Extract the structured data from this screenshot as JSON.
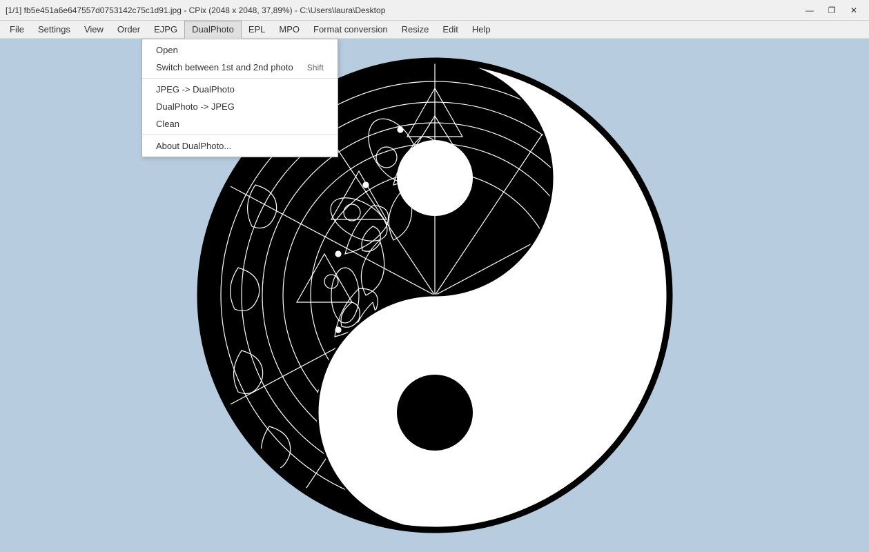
{
  "titlebar": {
    "text": "[1/1] fb5e451a6e647557d0753142c75c1d91.jpg - CPix (2048 x 2048, 37,89%) - C:\\Users\\laura\\Desktop",
    "minimize": "—",
    "maximize": "❐",
    "close": "✕"
  },
  "menubar": {
    "items": [
      {
        "id": "file",
        "label": "File"
      },
      {
        "id": "settings",
        "label": "Settings"
      },
      {
        "id": "view",
        "label": "View"
      },
      {
        "id": "order",
        "label": "Order"
      },
      {
        "id": "ejpg",
        "label": "EJPG"
      },
      {
        "id": "dualphoto",
        "label": "DualPhoto"
      },
      {
        "id": "epl",
        "label": "EPL"
      },
      {
        "id": "mpo",
        "label": "MPO"
      },
      {
        "id": "formatconversion",
        "label": "Format conversion"
      },
      {
        "id": "resize",
        "label": "Resize"
      },
      {
        "id": "edit",
        "label": "Edit"
      },
      {
        "id": "help",
        "label": "Help"
      }
    ]
  },
  "dropdown": {
    "items": [
      {
        "id": "open",
        "label": "Open",
        "shortcut": ""
      },
      {
        "id": "switch",
        "label": "Switch between 1st and 2nd photo",
        "shortcut": "Shift"
      },
      {
        "id": "sep1",
        "separator": true
      },
      {
        "id": "jpeg-to-dual",
        "label": "JPEG -> DualPhoto",
        "shortcut": ""
      },
      {
        "id": "dual-to-jpeg",
        "label": "DualPhoto -> JPEG",
        "shortcut": ""
      },
      {
        "id": "clean",
        "label": "Clean",
        "shortcut": ""
      },
      {
        "id": "sep2",
        "separator": true
      },
      {
        "id": "about",
        "label": "About DualPhoto...",
        "shortcut": ""
      }
    ]
  }
}
